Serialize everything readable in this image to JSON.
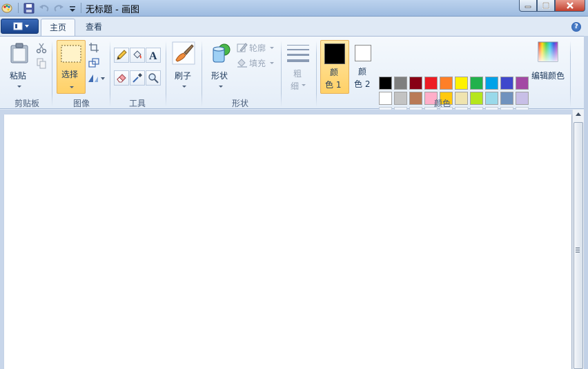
{
  "window": {
    "title": "无标题 - 画图"
  },
  "tabs": [
    {
      "label": "主页",
      "active": true
    },
    {
      "label": "查看",
      "active": false
    }
  ],
  "help_label": "?",
  "ribbon": {
    "clipboard": {
      "group_label": "剪贴板",
      "paste_label": "粘贴"
    },
    "image": {
      "group_label": "图像",
      "select_label": "选择"
    },
    "tools": {
      "group_label": "工具"
    },
    "brushes": {
      "label": "刷子"
    },
    "shapes": {
      "group_label": "形状",
      "shapes_label": "形状",
      "outline_label": "轮廓",
      "fill_label": "填充"
    },
    "size": {
      "label_line1": "粗",
      "label_line2": "细"
    },
    "colors": {
      "group_label": "颜色",
      "color1_line1": "颜",
      "color1_line2": "色 1",
      "color2_line1": "颜",
      "color2_line2": "色 2",
      "edit_label": "编辑颜色",
      "color1_value": "#000000",
      "color2_value": "#ffffff",
      "palette_row1": [
        "#000000",
        "#7f7f7f",
        "#880015",
        "#ed1c24",
        "#ff7f27",
        "#fff200",
        "#22b14c",
        "#00a2e8",
        "#3f48cc",
        "#a349a4"
      ],
      "palette_row2": [
        "#ffffff",
        "#c3c3c3",
        "#b97a57",
        "#ffaec9",
        "#ffc90e",
        "#efe4b0",
        "#b5e61d",
        "#99d9ea",
        "#7092be",
        "#c8bfe7"
      ]
    }
  }
}
